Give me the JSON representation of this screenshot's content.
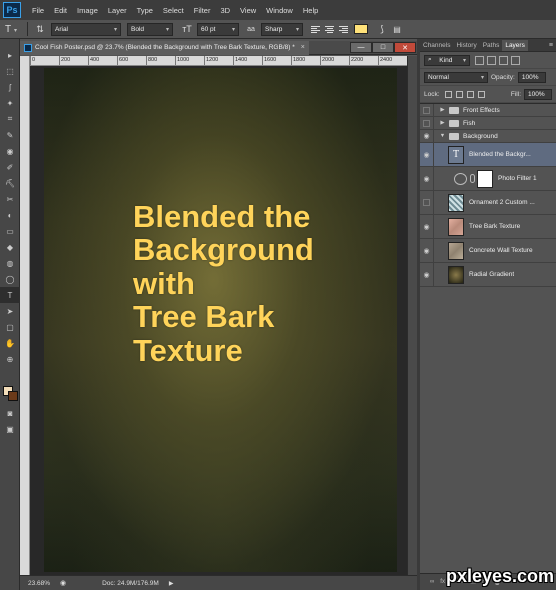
{
  "app": {
    "logo": "Ps"
  },
  "menu": [
    "File",
    "Edit",
    "Image",
    "Layer",
    "Type",
    "Select",
    "Filter",
    "3D",
    "View",
    "Window",
    "Help"
  ],
  "options": {
    "tool_icon": "type-tool-icon",
    "orientation_icon": "type-orientation-icon",
    "font_family": "Arial",
    "font_style": "Bold",
    "size_icon": "font-size-icon",
    "font_size": "60 pt",
    "aa_icon": "anti-alias-icon",
    "anti_alias": "Sharp",
    "text_color": "#ffe27a"
  },
  "document": {
    "tab_title": "Cool Fish Poster.psd @ 23.7% (Blended the Background with Tree Bark Texture, RGB/8) *",
    "close": "×",
    "window_buttons": [
      "—",
      "□",
      "✕"
    ],
    "ruler_ticks": [
      "0",
      "200",
      "400",
      "600",
      "800",
      "1000",
      "1200",
      "1400",
      "1600",
      "1800",
      "2000",
      "2200",
      "2400"
    ],
    "poster_text": [
      "Blended the",
      "Background",
      "with",
      "Tree Bark",
      "Texture"
    ],
    "poster_text_color": "#ffd45a"
  },
  "status": {
    "zoom": "23.68%",
    "doc_size": "Doc: 24.9M/176.9M"
  },
  "tools": [
    "▸",
    "⬚",
    "ʃ",
    "✦",
    "⌗",
    "✎",
    "◉",
    "✐",
    "⛏",
    "✂",
    "◐",
    "▭",
    "◆",
    "◍",
    "◯",
    "T",
    "➤",
    "▢",
    "✋",
    "⊕"
  ],
  "swatches": {
    "foreground": "#f3ddb9",
    "background": "#6b3a1a"
  },
  "layers_panel": {
    "tabs": [
      "Channels",
      "History",
      "Paths",
      "Layers"
    ],
    "active_tab": "Layers",
    "filter_kind": "Kind",
    "blend_mode": "Normal",
    "opacity_label": "Opacity:",
    "opacity": "100%",
    "lock_label": "Lock:",
    "fill_label": "Fill:",
    "fill": "100%",
    "layers": [
      {
        "name": "Front Effects",
        "kind": "group",
        "visible": false,
        "expanded": false
      },
      {
        "name": "Fish",
        "kind": "group",
        "visible": false,
        "expanded": false
      },
      {
        "name": "Background",
        "kind": "group",
        "visible": true,
        "expanded": true
      },
      {
        "name": "Blended the Backgr...",
        "kind": "text",
        "visible": true,
        "selected": true
      },
      {
        "name": "Photo Filter 1",
        "kind": "adjustment",
        "visible": true
      },
      {
        "name": "Ornament 2 Custom ...",
        "kind": "image",
        "visible": false
      },
      {
        "name": "Tree Bark Texture",
        "kind": "image",
        "visible": true
      },
      {
        "name": "Concrete Wall Texture",
        "kind": "image",
        "visible": true
      },
      {
        "name": "Radial Gradient",
        "kind": "image",
        "visible": true
      }
    ],
    "bottom_icons": [
      "link-icon",
      "fx-icon",
      "mask-icon",
      "adjustment-icon",
      "folder-icon",
      "new-layer-icon",
      "trash-icon"
    ]
  },
  "watermark": "pxleyes.com"
}
